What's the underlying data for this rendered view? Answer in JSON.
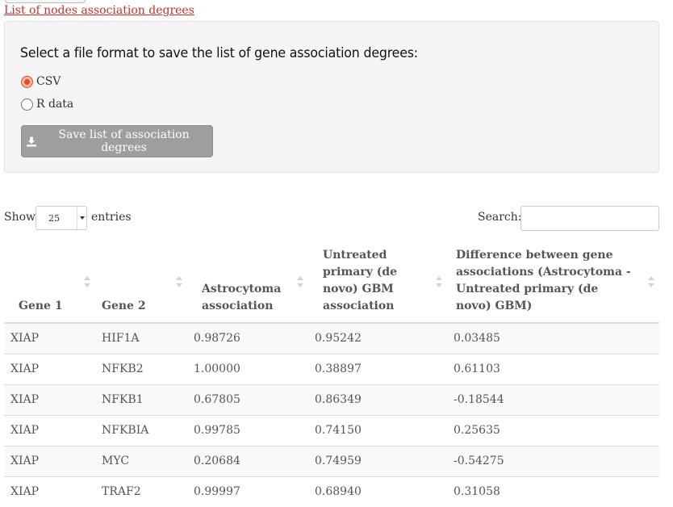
{
  "link_text": "List of nodes association degrees",
  "format_panel": {
    "title": "Select a file format to save the list of gene association degrees:",
    "options": [
      {
        "label": "CSV",
        "checked": true
      },
      {
        "label": "R data",
        "checked": false
      }
    ],
    "save_button_label": "Save list of association degrees",
    "save_button_icon": "download-icon"
  },
  "table_controls": {
    "show_label": "Show",
    "page_length": "25",
    "entries_label": "entries",
    "search_label": "Search:",
    "search_value": ""
  },
  "table": {
    "columns": [
      "Gene 1",
      "Gene 2",
      "Astrocytoma association",
      "Untreated primary (de novo) GBM association",
      "Difference between gene associations (Astrocytoma - Untreated primary (de novo) GBM)"
    ],
    "rows": [
      [
        "XIAP",
        "HIF1A",
        "0.98726",
        "0.95242",
        "0.03485"
      ],
      [
        "XIAP",
        "NFKB2",
        "1.00000",
        "0.38897",
        "0.61103"
      ],
      [
        "XIAP",
        "NFKB1",
        "0.67805",
        "0.86349",
        "-0.18544"
      ],
      [
        "XIAP",
        "NFKBIA",
        "0.99785",
        "0.74150",
        "0.25635"
      ],
      [
        "XIAP",
        "MYC",
        "0.20684",
        "0.74959",
        "-0.54275"
      ],
      [
        "XIAP",
        "TRAF2",
        "0.99997",
        "0.68940",
        "0.31058"
      ]
    ]
  },
  "colors": {
    "link": "#c9302c",
    "radio_checked": "#e2531b",
    "button_bg": "#9e9e9e",
    "stripe": "#f9f9f9"
  }
}
